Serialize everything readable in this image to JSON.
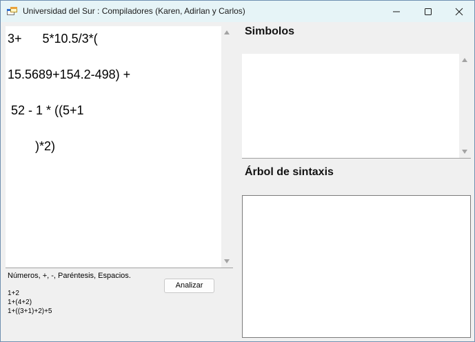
{
  "window": {
    "title": "Universidad del Sur : Compiladores (Karen, Adirlan y Carlos)",
    "icon": "app-icon",
    "controls": [
      "minimize-icon",
      "maximize-icon",
      "close-icon"
    ]
  },
  "editor": {
    "lines": [
      "3+      5*10.5/3*(",
      "15.5689+154.2-498) +",
      " 52 - 1 * ((5+1",
      "        )*2)"
    ]
  },
  "hint": {
    "text": "Números, +, -, Paréntesis, Espacios."
  },
  "analyze_button": {
    "label": "Analizar"
  },
  "examples": [
    "1+2",
    "1+(4+2)",
    "1+((3+1)+2)+5"
  ],
  "symbols": {
    "title": "Simbolos"
  },
  "syntax_tree": {
    "title": "Árbol de sintaxis"
  },
  "colors": {
    "titlebar": "#e6f4f7",
    "client_background": "#f0f0f0",
    "textbox_background": "#ffffff"
  }
}
